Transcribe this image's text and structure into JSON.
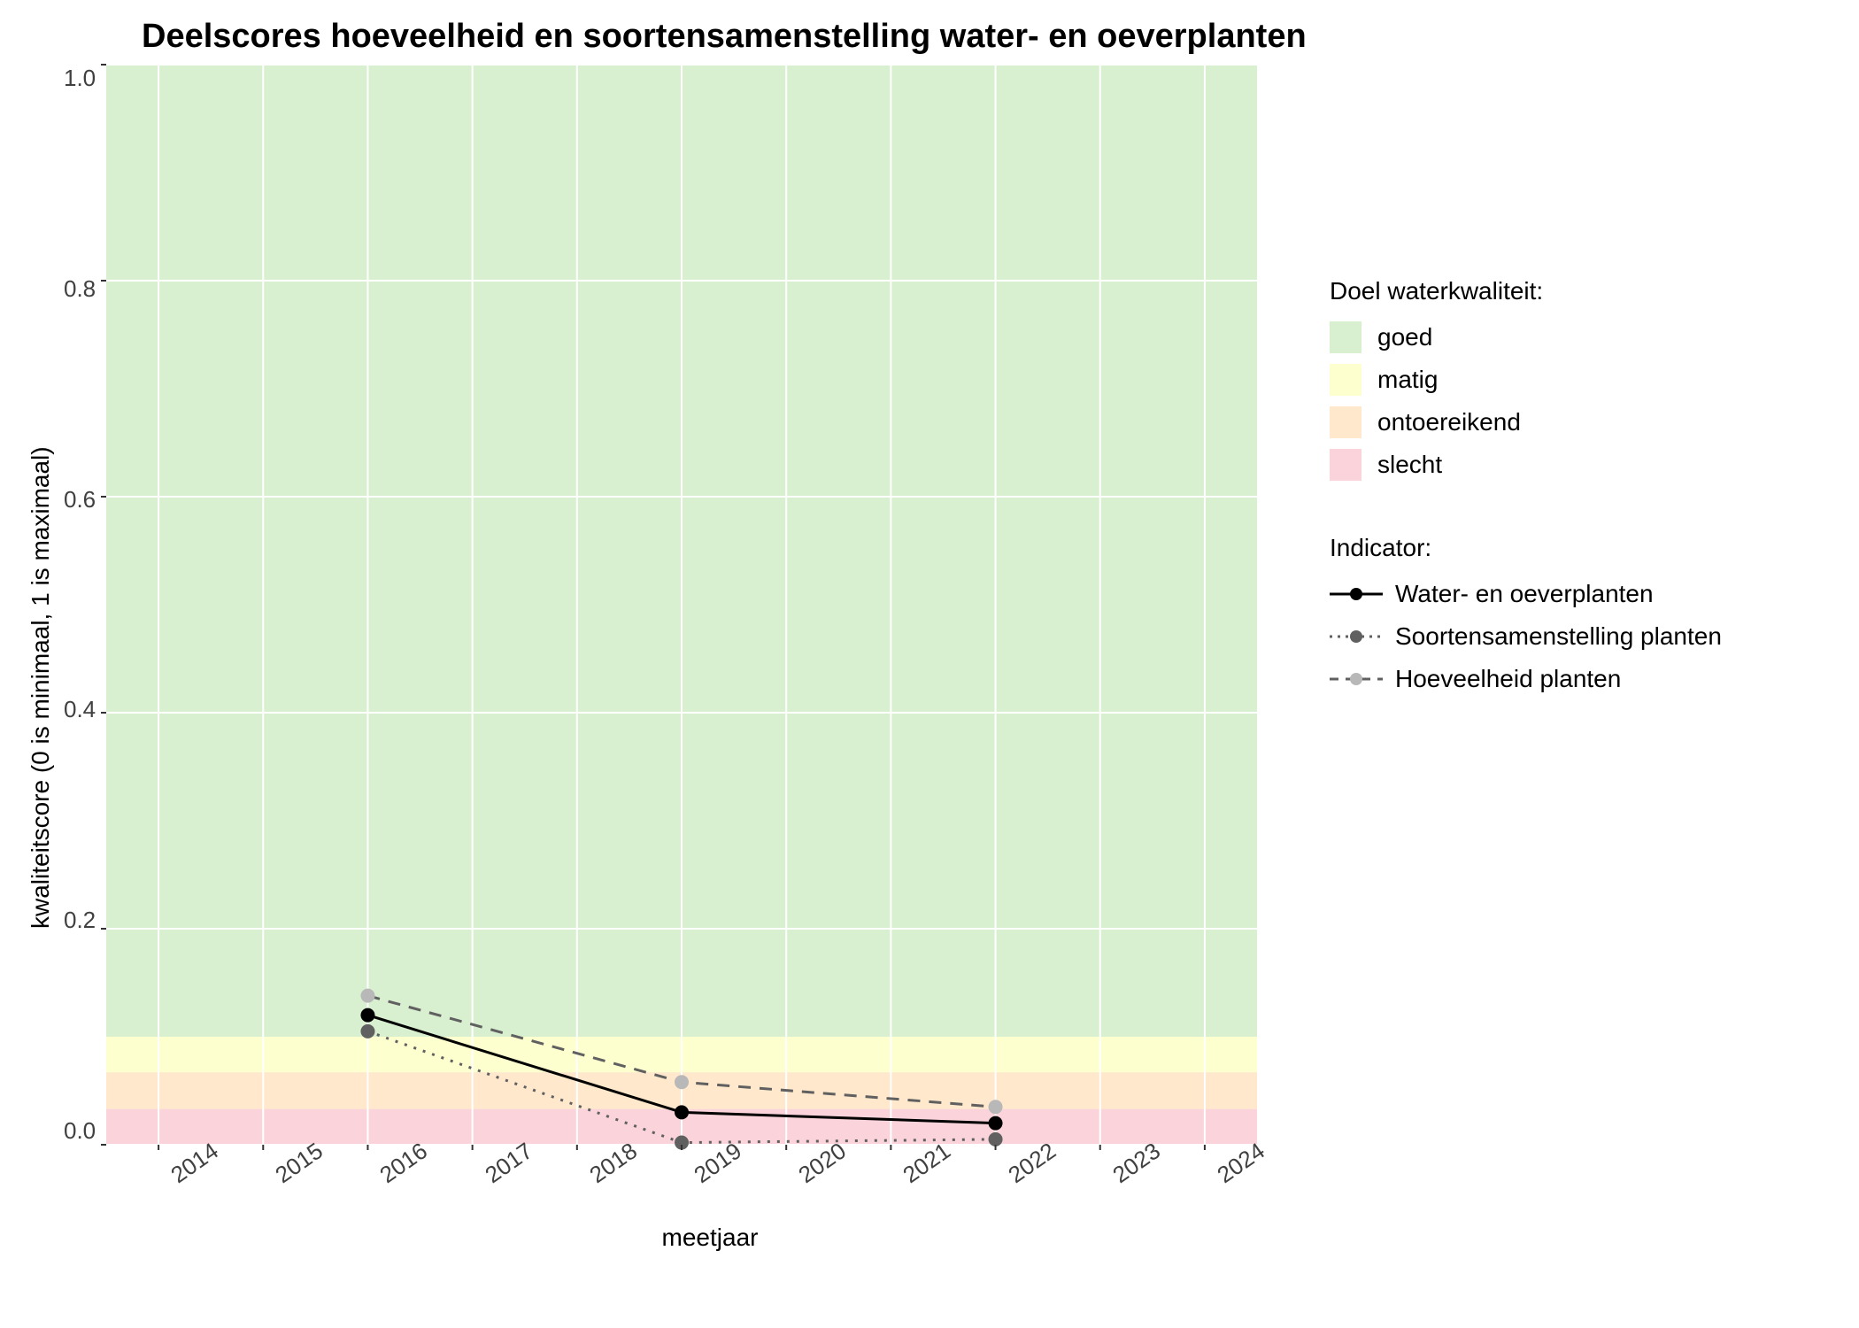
{
  "chart_data": {
    "type": "line",
    "title": "Deelscores hoeveelheid en soortensamenstelling water- en oeverplanten",
    "xlabel": "meetjaar",
    "ylabel": "kwaliteitscore (0 is minimaal, 1 is maximaal)",
    "x_ticks": [
      "2014",
      "2015",
      "2016",
      "2017",
      "2018",
      "2019",
      "2020",
      "2021",
      "2022",
      "2023",
      "2024"
    ],
    "y_ticks": [
      "0.0",
      "0.2",
      "0.4",
      "0.6",
      "0.8",
      "1.0"
    ],
    "xlim": [
      2014,
      2024
    ],
    "ylim": [
      0,
      1
    ],
    "bands": [
      {
        "name": "goed",
        "from": 0.1,
        "to": 1.0,
        "color": "#d9f0d0"
      },
      {
        "name": "matig",
        "from": 0.067,
        "to": 0.1,
        "color": "#feffcf"
      },
      {
        "name": "ontoereikend",
        "from": 0.033,
        "to": 0.067,
        "color": "#ffe8cc"
      },
      {
        "name": "slecht",
        "from": 0.0,
        "to": 0.033,
        "color": "#fbd4db"
      }
    ],
    "series": [
      {
        "name": "Water- en oeverplanten",
        "color": "#000000",
        "marker_color": "#000000",
        "dash": "solid",
        "x": [
          2016,
          2019,
          2022
        ],
        "y": [
          0.12,
          0.03,
          0.02
        ]
      },
      {
        "name": "Soortensamenstelling planten",
        "color": "#606060",
        "marker_color": "#606060",
        "dash": "dotted",
        "x": [
          2016,
          2019,
          2022
        ],
        "y": [
          0.105,
          0.002,
          0.005
        ]
      },
      {
        "name": "Hoeveelheid planten",
        "color": "#606060",
        "marker_color": "#b8b8b8",
        "dash": "dashed",
        "x": [
          2016,
          2019,
          2022
        ],
        "y": [
          0.138,
          0.058,
          0.035
        ]
      }
    ],
    "legend1_title": "Doel waterkwaliteit:",
    "legend1_items": [
      {
        "label": "goed",
        "color": "#d9f0d0"
      },
      {
        "label": "matig",
        "color": "#feffcf"
      },
      {
        "label": "ontoereikend",
        "color": "#ffe8cc"
      },
      {
        "label": "slecht",
        "color": "#fbd4db"
      }
    ],
    "legend2_title": "Indicator:",
    "legend2_items": [
      {
        "label": "Water- en oeverplanten"
      },
      {
        "label": "Soortensamenstelling planten"
      },
      {
        "label": "Hoeveelheid planten"
      }
    ]
  }
}
